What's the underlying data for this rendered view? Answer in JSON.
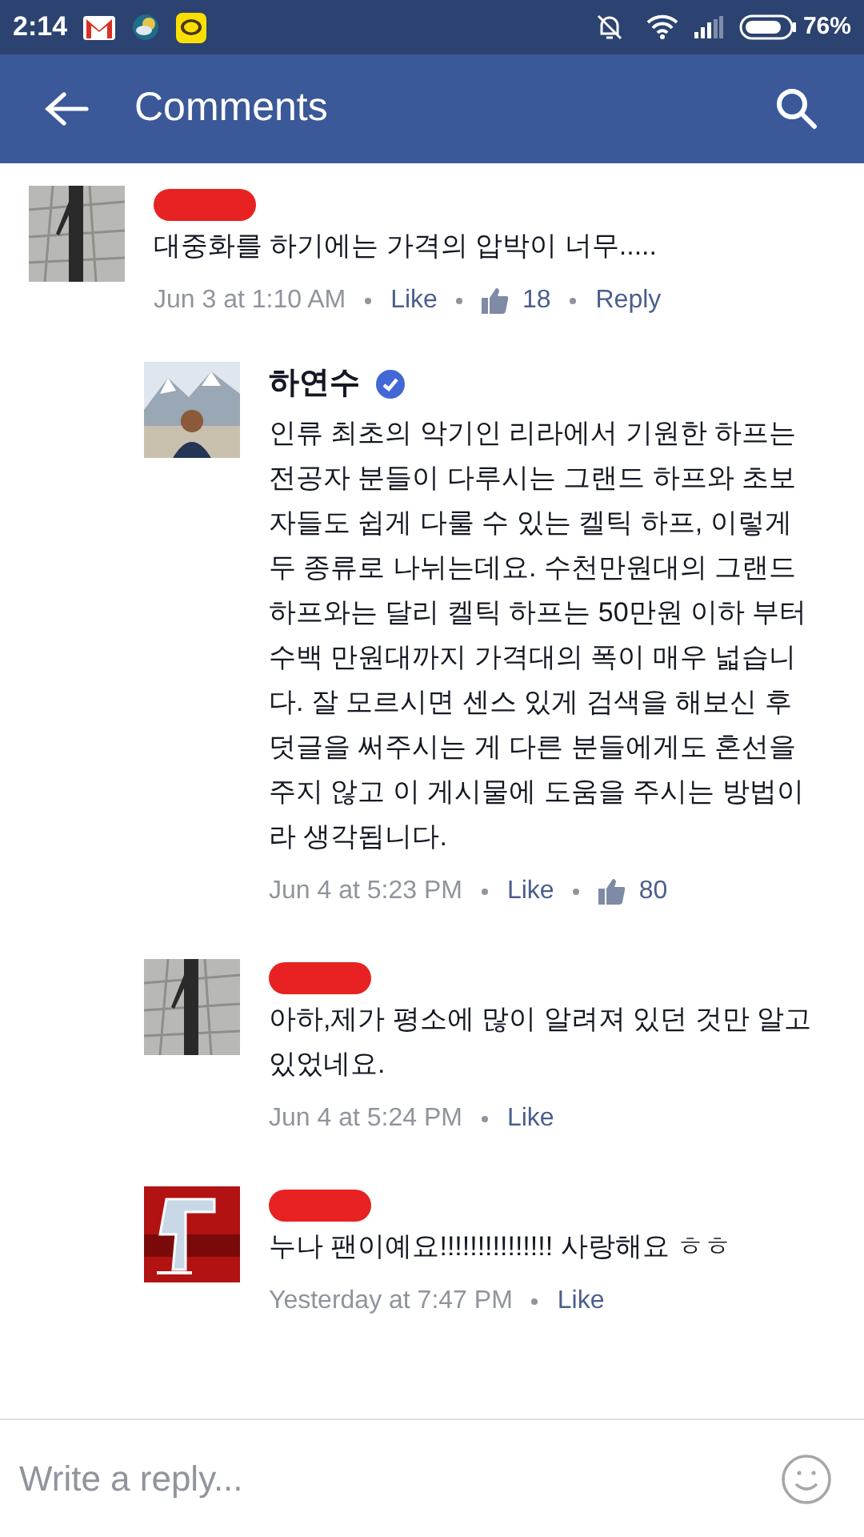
{
  "status_bar": {
    "time": "2:14",
    "battery": "76%"
  },
  "header": {
    "title": "Comments"
  },
  "comment": {
    "name_hidden": true,
    "text": "대중화를 하기에는 가격의 압박이 너무.....",
    "time": "Jun 3 at 1:10 AM",
    "like_label": "Like",
    "likes": "18",
    "reply_label": "Reply"
  },
  "replies": [
    {
      "name": "하연수",
      "verified": true,
      "name_hidden": false,
      "text": "인류 최초의 악기인 리라에서 기원한 하프는 전공자 분들이 다루시는 그랜드 하프와 초보자들도 쉽게 다룰 수 있는 켈틱 하프, 이렇게 두 종류로 나뉘는데요. 수천만원대의 그랜드 하프와는 달리 켈틱 하프는 50만원 이하 부터 수백 만원대까지 가격대의 폭이 매우 넓습니다. 잘 모르시면 센스 있게 검색을 해보신 후 덧글을 써주시는 게 다른 분들에게도 혼선을 주지 않고 이 게시물에 도움을 주시는 방법이라 생각됩니다.",
      "time": "Jun 4 at 5:23 PM",
      "like_label": "Like",
      "likes": "80"
    },
    {
      "name_hidden": true,
      "text": "아하,제가 평소에 많이 알려져 있던 것만 알고 있었네요.",
      "time": "Jun 4 at 5:24 PM",
      "like_label": "Like"
    },
    {
      "name_hidden": true,
      "text": "누나 팬이예요!!!!!!!!!!!!!!! 사랑해요 ㅎㅎ",
      "time": "Yesterday at 7:47 PM",
      "like_label": "Like"
    }
  ],
  "reply_bar": {
    "placeholder": "Write a reply..."
  }
}
